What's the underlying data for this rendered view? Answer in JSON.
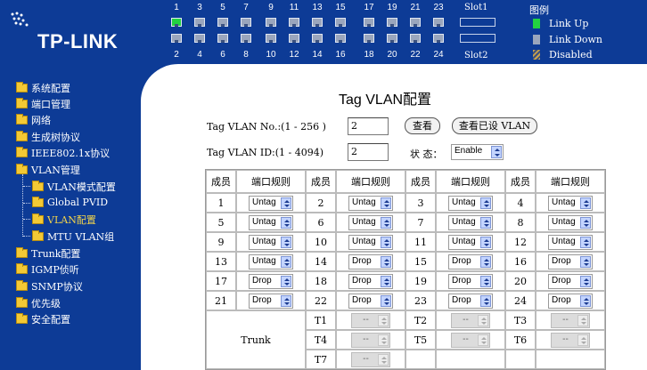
{
  "header": {
    "brand": "TP-LINK",
    "ports_top": [
      "1",
      "3",
      "5",
      "7",
      "9",
      "11",
      "13",
      "15",
      "17",
      "19",
      "21",
      "23"
    ],
    "ports_bottom": [
      "2",
      "4",
      "6",
      "8",
      "10",
      "12",
      "14",
      "16",
      "18",
      "20",
      "22",
      "24"
    ],
    "slots": [
      "Slot1",
      "Slot2"
    ],
    "legend": {
      "title": "图例",
      "up": "Link Up",
      "down": "Link Down",
      "disabled": "Disabled"
    },
    "colors": {
      "header_bg": "#0d3b96",
      "link_up": "#22d340",
      "link_down": "#9aa6bd"
    }
  },
  "sidebar": {
    "items": [
      {
        "label": "系统配置"
      },
      {
        "label": "端口管理"
      },
      {
        "label": "网络"
      },
      {
        "label": "生成树协议"
      },
      {
        "label": "IEEE802.1x协议"
      },
      {
        "label": "VLAN管理"
      },
      {
        "label": "VLAN模式配置"
      },
      {
        "label": "Global PVID"
      },
      {
        "label": "VLAN配置"
      },
      {
        "label": "MTU VLAN组"
      },
      {
        "label": "Trunk配置"
      },
      {
        "label": "IGMP侦听"
      },
      {
        "label": "SNMP协议"
      },
      {
        "label": "优先级"
      },
      {
        "label": "安全配置"
      }
    ]
  },
  "main": {
    "title": "Tag VLAN配置",
    "vlan_no_label": "Tag VLAN No.:(1 - 256 )",
    "vlan_no_value": "2",
    "view_button": "查看",
    "view_all_button": "查看已设 VLAN",
    "vlan_id_label": "Tag VLAN ID:(1 - 4094)",
    "vlan_id_value": "2",
    "status_label": "状 态：",
    "status_value": "Enable",
    "table_headers": {
      "member": "成员",
      "rule": "端口规则"
    },
    "rows": [
      [
        {
          "p": "1",
          "r": "Untag"
        },
        {
          "p": "2",
          "r": "Untag"
        },
        {
          "p": "3",
          "r": "Untag"
        },
        {
          "p": "4",
          "r": "Untag"
        }
      ],
      [
        {
          "p": "5",
          "r": "Untag"
        },
        {
          "p": "6",
          "r": "Untag"
        },
        {
          "p": "7",
          "r": "Untag"
        },
        {
          "p": "8",
          "r": "Untag"
        }
      ],
      [
        {
          "p": "9",
          "r": "Untag"
        },
        {
          "p": "10",
          "r": "Untag"
        },
        {
          "p": "11",
          "r": "Untag"
        },
        {
          "p": "12",
          "r": "Untag"
        }
      ],
      [
        {
          "p": "13",
          "r": "Untag"
        },
        {
          "p": "14",
          "r": "Drop"
        },
        {
          "p": "15",
          "r": "Drop"
        },
        {
          "p": "16",
          "r": "Drop"
        }
      ],
      [
        {
          "p": "17",
          "r": "Drop"
        },
        {
          "p": "18",
          "r": "Drop"
        },
        {
          "p": "19",
          "r": "Drop"
        },
        {
          "p": "20",
          "r": "Drop"
        }
      ],
      [
        {
          "p": "21",
          "r": "Drop"
        },
        {
          "p": "22",
          "r": "Drop"
        },
        {
          "p": "23",
          "r": "Drop"
        },
        {
          "p": "24",
          "r": "Drop"
        }
      ]
    ],
    "trunk_label": "Trunk",
    "trunks": [
      [
        {
          "t": "T1",
          "v": "--"
        },
        {
          "t": "T2",
          "v": "--"
        },
        {
          "t": "T3",
          "v": "--"
        }
      ],
      [
        {
          "t": "T4",
          "v": "--"
        },
        {
          "t": "T5",
          "v": "--"
        },
        {
          "t": "T6",
          "v": "--"
        }
      ],
      [
        {
          "t": "T7",
          "v": "--"
        }
      ]
    ]
  }
}
